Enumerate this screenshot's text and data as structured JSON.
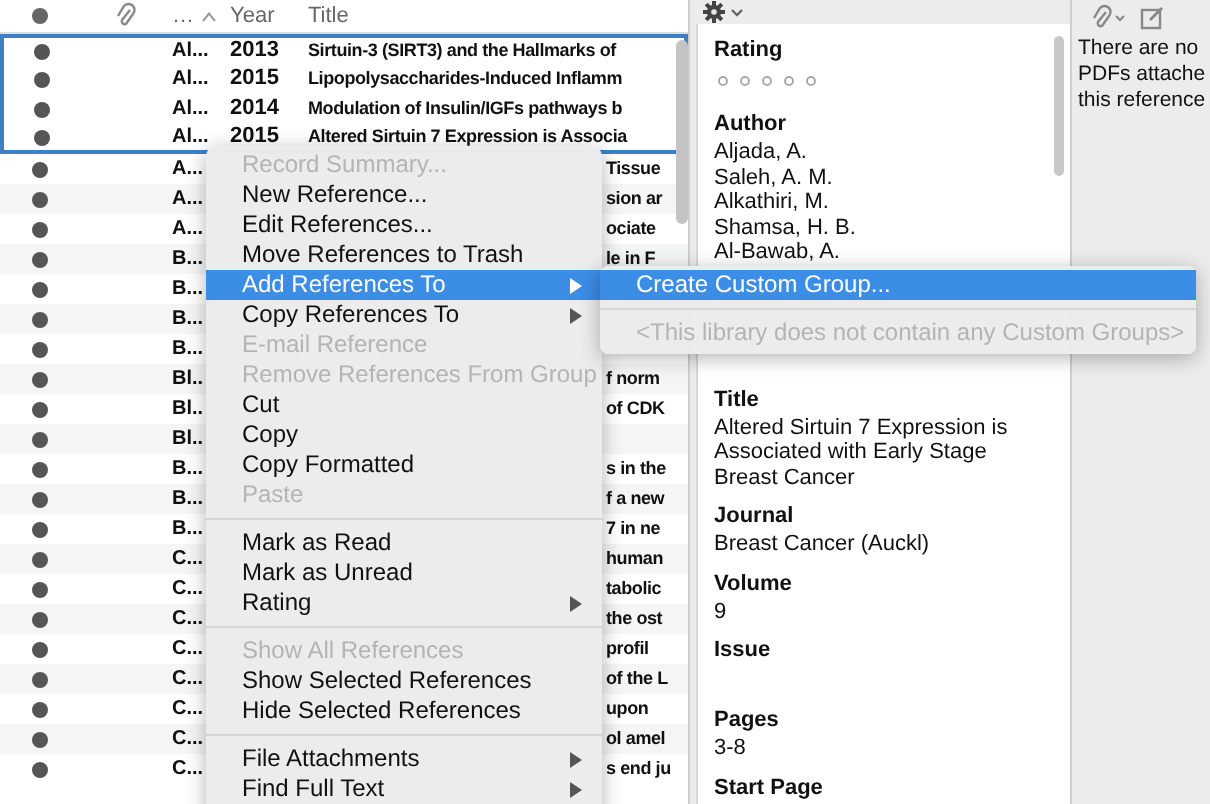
{
  "table": {
    "columns": [
      {
        "kind": "dot"
      },
      {
        "kind": "attachment"
      },
      {
        "kind": "text",
        "label": "…"
      },
      {
        "kind": "text",
        "label": "Year"
      },
      {
        "kind": "text",
        "label": "Title"
      }
    ],
    "rows": [
      {
        "author": "Al...",
        "year": "2013",
        "title": "Sirtuin-3 (SIRT3) and the Hallmarks of",
        "selected": true
      },
      {
        "author": "Al...",
        "year": "2015",
        "title": "Lipopolysaccharides-Induced Inflamm",
        "selected": true
      },
      {
        "author": "Al...",
        "year": "2014",
        "title": "Modulation of Insulin/IGFs pathways b",
        "selected": true
      },
      {
        "author": "Al...",
        "year": "2015",
        "title": "Altered Sirtuin 7 Expression is Associa",
        "selected": true
      },
      {
        "author": "A...",
        "title": "Tissue",
        "selected": false
      },
      {
        "author": "A...",
        "title": "sion ar",
        "selected": false
      },
      {
        "author": "A...",
        "title": "ociate",
        "selected": false
      },
      {
        "author": "B...",
        "title": "le in F",
        "selected": false
      },
      {
        "author": "B...",
        "selected": false
      },
      {
        "author": "B...",
        "selected": false
      },
      {
        "author": "B...",
        "selected": false
      },
      {
        "author": "Bl..",
        "title": "f norm",
        "selected": false
      },
      {
        "author": "Bl..",
        "title": "of CDK",
        "selected": false
      },
      {
        "author": "Bl..",
        "selected": false
      },
      {
        "author": "B...",
        "title": "s in the",
        "selected": false
      },
      {
        "author": "B...",
        "title": "f a new",
        "selected": false
      },
      {
        "author": "B...",
        "title": "7 in ne",
        "selected": false
      },
      {
        "author": "C...",
        "title": "human",
        "selected": false
      },
      {
        "author": "C...",
        "title": "tabolic",
        "selected": false
      },
      {
        "author": "C...",
        "title": "the ost",
        "selected": false
      },
      {
        "author": "C...",
        "title": "profil",
        "selected": false
      },
      {
        "author": "C...",
        "title": "of the L",
        "selected": false
      },
      {
        "author": "C...",
        "title": "upon",
        "selected": false
      },
      {
        "author": "C...",
        "title": "ol amel",
        "selected": false
      },
      {
        "author": "C...",
        "title": "s end ju",
        "selected": false
      }
    ]
  },
  "context_menu": [
    {
      "kind": "item",
      "label": "Record Summary...",
      "disabled": true,
      "selected": false,
      "submenu": false
    },
    {
      "kind": "item",
      "label": "New Reference...",
      "disabled": false,
      "selected": false,
      "submenu": false
    },
    {
      "kind": "item",
      "label": "Edit References...",
      "disabled": false,
      "selected": false,
      "submenu": false
    },
    {
      "kind": "item",
      "label": "Move References to Trash",
      "disabled": false,
      "selected": false,
      "submenu": false
    },
    {
      "kind": "item",
      "label": "Add References To",
      "disabled": false,
      "selected": true,
      "submenu": true
    },
    {
      "kind": "item",
      "label": "Copy References To",
      "disabled": false,
      "selected": false,
      "submenu": true
    },
    {
      "kind": "item",
      "label": "E-mail Reference",
      "disabled": true,
      "selected": false,
      "submenu": false
    },
    {
      "kind": "item",
      "label": "Remove References From Group",
      "disabled": true,
      "selected": false,
      "submenu": false
    },
    {
      "kind": "item",
      "label": "Cut",
      "disabled": false,
      "selected": false,
      "submenu": false
    },
    {
      "kind": "item",
      "label": "Copy",
      "disabled": false,
      "selected": false,
      "submenu": false
    },
    {
      "kind": "item",
      "label": "Copy Formatted",
      "disabled": false,
      "selected": false,
      "submenu": false
    },
    {
      "kind": "item",
      "label": "Paste",
      "disabled": true,
      "selected": false,
      "submenu": false
    },
    {
      "kind": "separator"
    },
    {
      "kind": "item",
      "label": "Mark as Read",
      "disabled": false,
      "selected": false,
      "submenu": false
    },
    {
      "kind": "item",
      "label": "Mark as Unread",
      "disabled": false,
      "selected": false,
      "submenu": false
    },
    {
      "kind": "item",
      "label": "Rating",
      "disabled": false,
      "selected": false,
      "submenu": true
    },
    {
      "kind": "separator"
    },
    {
      "kind": "item",
      "label": "Show All References",
      "disabled": true,
      "selected": false,
      "submenu": false
    },
    {
      "kind": "item",
      "label": "Show Selected References",
      "disabled": false,
      "selected": false,
      "submenu": false
    },
    {
      "kind": "item",
      "label": "Hide Selected References",
      "disabled": false,
      "selected": false,
      "submenu": false
    },
    {
      "kind": "separator"
    },
    {
      "kind": "item",
      "label": "File Attachments",
      "disabled": false,
      "selected": false,
      "submenu": true
    },
    {
      "kind": "item",
      "label": "Find Full Text",
      "disabled": false,
      "selected": false,
      "submenu": true
    }
  ],
  "submenu": [
    {
      "kind": "item",
      "label": "Create Custom Group...",
      "disabled": false,
      "selected": true
    },
    {
      "kind": "separator"
    },
    {
      "kind": "item",
      "label": "<This library does not contain any Custom Groups>",
      "disabled": true,
      "selected": false
    }
  ],
  "reference_panel": {
    "rating_label": "Rating",
    "stars": 0,
    "fields": [
      {
        "label": "Author",
        "values": [
          "Aljada, A.",
          "Saleh, A. M.",
          "Alkathiri, M.",
          "Shamsa, H. B.",
          "Al-Bawab, A."
        ]
      },
      {
        "label": "Title",
        "values": [
          "Altered Sirtuin 7 Expression is Associated with Early Stage Breast Cancer"
        ]
      },
      {
        "label": "Journal",
        "values": [
          "Breast Cancer (Auckl)"
        ]
      },
      {
        "label": "Volume",
        "values": [
          "9"
        ]
      },
      {
        "label": "Issue"
      },
      {
        "label": "Pages",
        "values": [
          "3-8"
        ]
      },
      {
        "label": "Start Page"
      }
    ]
  },
  "pdf_pane": {
    "message_lines": [
      "There are no",
      "PDFs attache",
      "this reference"
    ]
  }
}
